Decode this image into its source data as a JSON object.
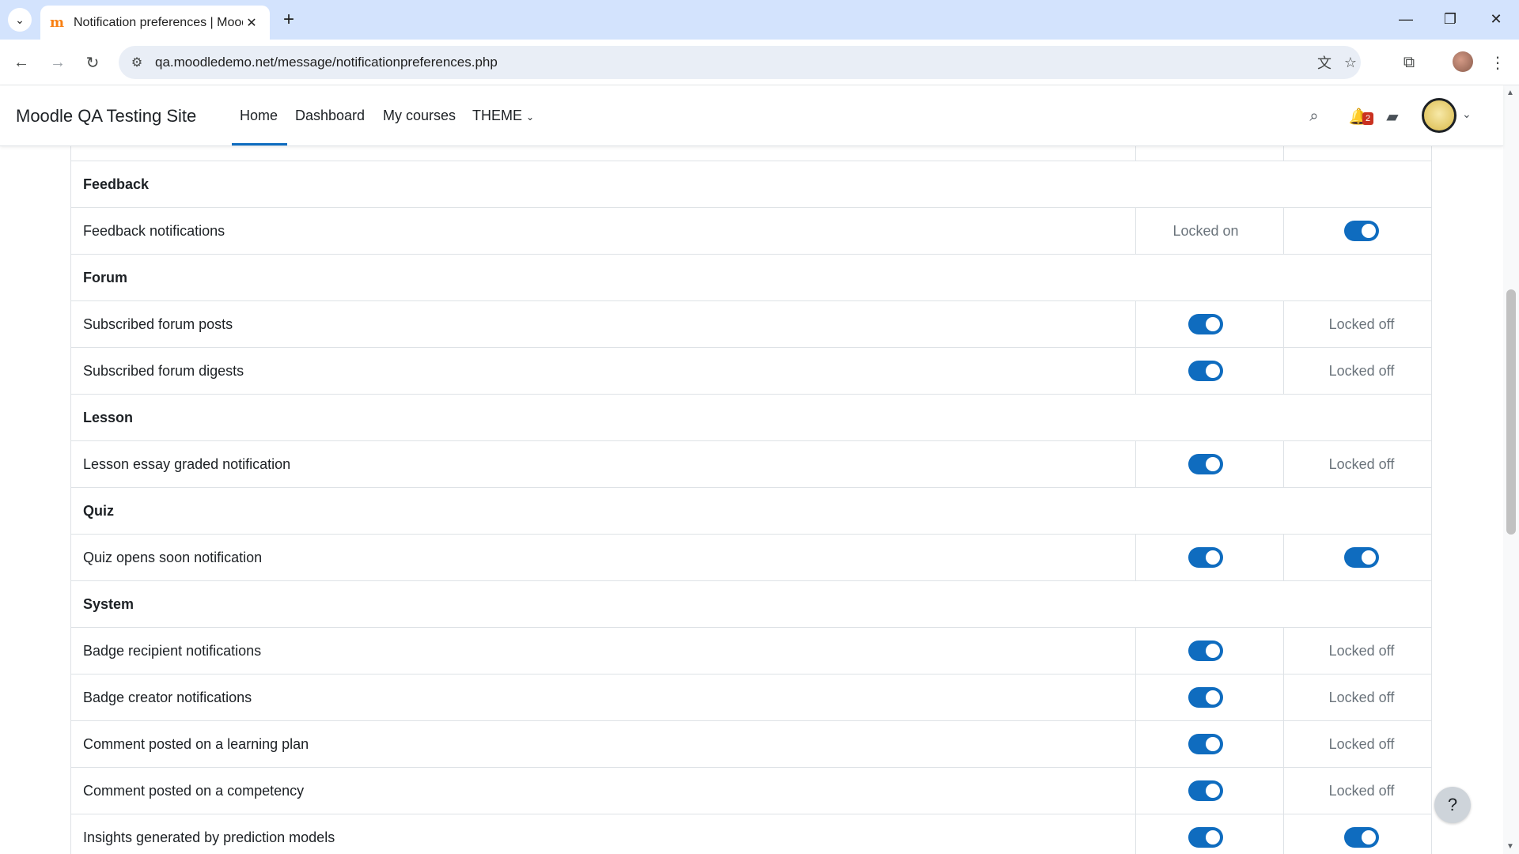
{
  "browser": {
    "tab_title": "Notification preferences | Mood",
    "url": "qa.moodledemo.net/message/notificationpreferences.php"
  },
  "navbar": {
    "site_name": "Moodle QA Testing Site",
    "items": [
      {
        "label": "Home",
        "active": true
      },
      {
        "label": "Dashboard"
      },
      {
        "label": "My courses"
      },
      {
        "label": "THEME"
      }
    ],
    "notification_count": "2"
  },
  "preferences": {
    "rows": [
      {
        "type": "stub"
      },
      {
        "type": "section",
        "label": "Feedback"
      },
      {
        "type": "item",
        "label": "Feedback notifications",
        "web": "Locked on",
        "email": "toggle-on"
      },
      {
        "type": "section",
        "label": "Forum"
      },
      {
        "type": "item",
        "label": "Subscribed forum posts",
        "web": "toggle-on",
        "email": "Locked off"
      },
      {
        "type": "item",
        "label": "Subscribed forum digests",
        "web": "toggle-on",
        "email": "Locked off"
      },
      {
        "type": "section",
        "label": "Lesson"
      },
      {
        "type": "item",
        "label": "Lesson essay graded notification",
        "web": "toggle-on",
        "email": "Locked off"
      },
      {
        "type": "section",
        "label": "Quiz"
      },
      {
        "type": "item",
        "label": "Quiz opens soon notification",
        "web": "toggle-on",
        "email": "toggle-on"
      },
      {
        "type": "section",
        "label": "System"
      },
      {
        "type": "item",
        "label": "Badge recipient notifications",
        "web": "toggle-on",
        "email": "Locked off"
      },
      {
        "type": "item",
        "label": "Badge creator notifications",
        "web": "toggle-on",
        "email": "Locked off"
      },
      {
        "type": "item",
        "label": "Comment posted on a learning plan",
        "web": "toggle-on",
        "email": "Locked off"
      },
      {
        "type": "item",
        "label": "Comment posted on a competency",
        "web": "toggle-on",
        "email": "Locked off"
      },
      {
        "type": "item",
        "label": "Insights generated by prediction models",
        "web": "toggle-on",
        "email": "toggle-on"
      }
    ]
  },
  "help": {
    "label": "?"
  },
  "colors": {
    "accent": "#0f6cbf",
    "chrome": "#d3e3fd",
    "badge": "#ca3120"
  }
}
